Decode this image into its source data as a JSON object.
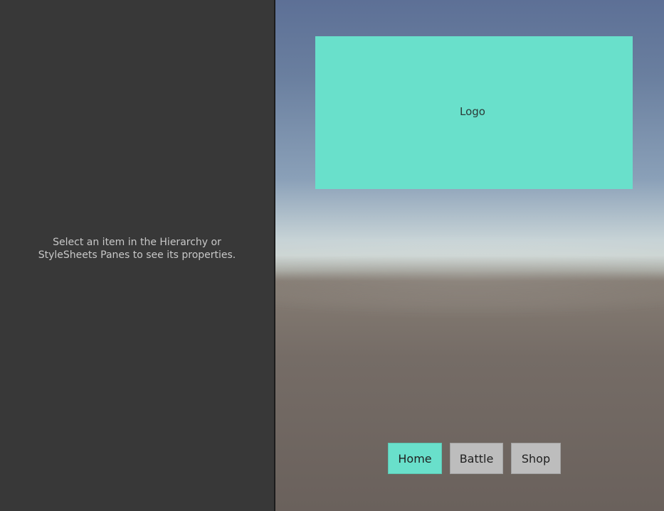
{
  "inspector": {
    "message": "Select an item in the Hierarchy or StyleSheets Panes to see its properties."
  },
  "viewport": {
    "logo_label": "Logo",
    "nav": {
      "items": [
        {
          "label": "Home",
          "active": true
        },
        {
          "label": "Battle",
          "active": false
        },
        {
          "label": "Shop",
          "active": false
        }
      ]
    }
  },
  "colors": {
    "accent": "#69e0cb",
    "button_inactive": "#bdbdbd",
    "panel_background": "#383838"
  }
}
